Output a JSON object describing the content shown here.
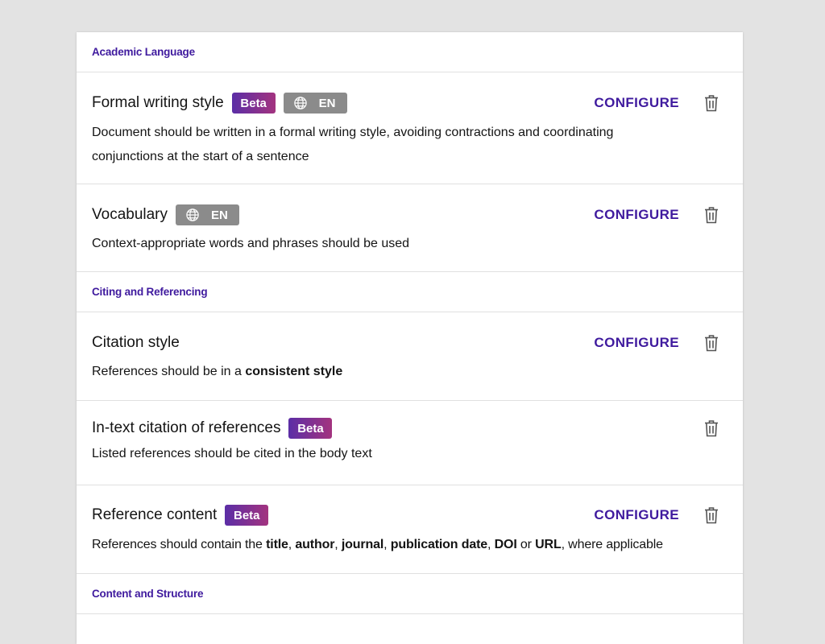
{
  "sections": [
    {
      "title": "Academic Language",
      "rules": [
        {
          "title": "Formal writing style",
          "beta": "Beta",
          "lang": "EN",
          "configure": "CONFIGURE",
          "desc": "Document should be written in a formal writing style, avoiding contractions and coordinating conjunctions at the start of a sentence"
        },
        {
          "title": "Vocabulary",
          "lang": "EN",
          "configure": "CONFIGURE",
          "desc": "Context-appropriate words and phrases should be used"
        }
      ]
    },
    {
      "title": "Citing and Referencing",
      "rules": [
        {
          "title": "Citation style",
          "configure": "CONFIGURE",
          "desc": {
            "prefix": "References should be in a ",
            "bold": "consistent style"
          }
        },
        {
          "title": "In-text citation of references",
          "beta": "Beta",
          "desc": "Listed references should be cited in the body text"
        },
        {
          "title": "Reference content",
          "beta": "Beta",
          "configure": "CONFIGURE",
          "desc": {
            "t0": "References should contain the ",
            "b0": "title",
            "t1": ", ",
            "b1": "author",
            "t2": ", ",
            "b2": "journal",
            "t3": ", ",
            "b3": "publication date",
            "t4": ", ",
            "b4": "DOI",
            "t5": " or ",
            "b5": "URL",
            "t6": ", where applicable"
          }
        }
      ]
    },
    {
      "title": "Content and Structure",
      "rules": []
    }
  ],
  "icons": {
    "globe": "globe-icon",
    "trash": "trash-icon"
  },
  "colors": {
    "accent": "#3f1a9e",
    "beta_start": "#5b2ea6",
    "beta_end": "#a3337f",
    "lang_badge": "#8b8b8b"
  }
}
